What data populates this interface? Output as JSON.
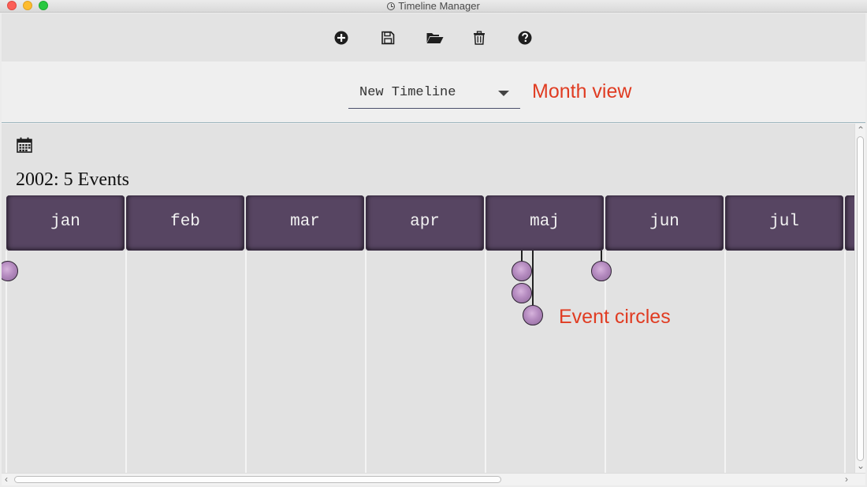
{
  "window": {
    "title": "Timeline Manager"
  },
  "toolbar": {
    "buttons": [
      {
        "name": "add-button",
        "icon": "plus-circle-icon"
      },
      {
        "name": "save-button",
        "icon": "floppy-disk-icon"
      },
      {
        "name": "open-button",
        "icon": "folder-open-icon"
      },
      {
        "name": "delete-button",
        "icon": "trash-icon"
      },
      {
        "name": "help-button",
        "icon": "question-circle-icon"
      }
    ]
  },
  "selector": {
    "timeline_value": "New Timeline",
    "annotation": "Month view"
  },
  "timeline": {
    "calendar_icon": "calendar-icon",
    "year_summary": "2002: 5 Events",
    "months": [
      "jan",
      "feb",
      "mar",
      "apr",
      "maj",
      "jun",
      "jul"
    ],
    "event_annotation": "Event circles",
    "event_count": 5,
    "colors": {
      "month_block": "#574562",
      "event_fill": "#b48abf",
      "annotation": "#e03c22"
    }
  }
}
